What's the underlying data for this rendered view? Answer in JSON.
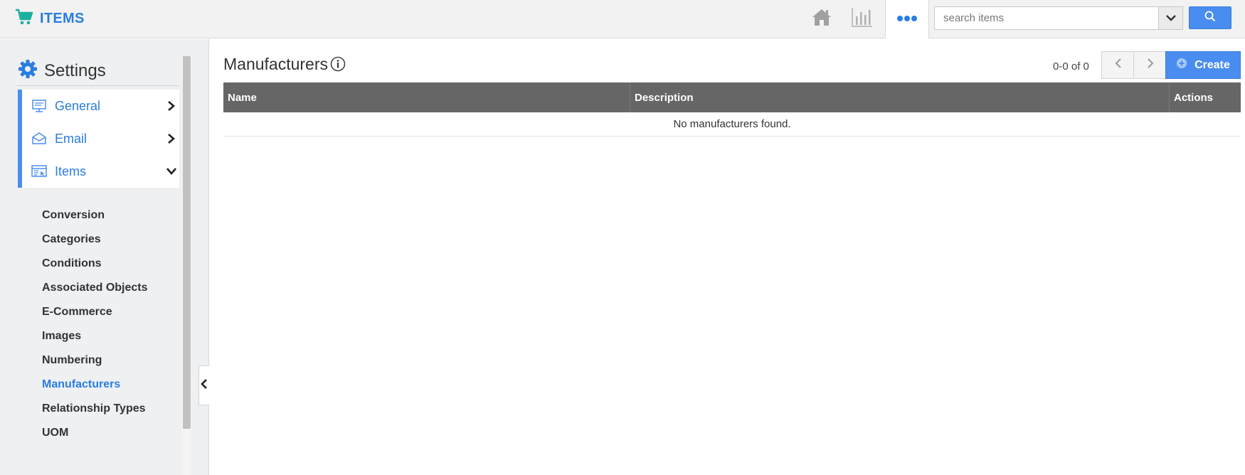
{
  "app": {
    "title": "ITEMS",
    "brand_color": "#2a7de1",
    "cart_icon_color": "#1ab0a0"
  },
  "topbar": {
    "icons": [
      "home-icon",
      "bar-chart-icon",
      "more-dots-icon"
    ],
    "search": {
      "placeholder": "search items",
      "value": ""
    }
  },
  "sidebar": {
    "title": "Settings",
    "sections": [
      {
        "label": "General",
        "icon": "monitor-icon",
        "state": "collapsed"
      },
      {
        "label": "Email",
        "icon": "envelope-icon",
        "state": "collapsed"
      },
      {
        "label": "Items",
        "icon": "items-window-icon",
        "state": "expanded"
      }
    ],
    "sub_items": [
      {
        "label": "Conversion"
      },
      {
        "label": "Categories"
      },
      {
        "label": "Conditions"
      },
      {
        "label": "Associated Objects"
      },
      {
        "label": "E-Commerce"
      },
      {
        "label": "Images"
      },
      {
        "label": "Numbering"
      },
      {
        "label": "Manufacturers",
        "active": true
      },
      {
        "label": "Relationship Types"
      },
      {
        "label": "UOM"
      }
    ]
  },
  "main": {
    "title": "Manufacturers",
    "pager": {
      "count_text": "0-0 of 0"
    },
    "create_label": "Create",
    "table": {
      "columns": [
        "Name",
        "Description",
        "Actions"
      ],
      "rows": [],
      "empty_message": "No manufacturers found."
    }
  },
  "colors": {
    "accent": "#4a8df0",
    "table_header_bg": "#666666",
    "sidebar_bg": "#eef0f2"
  }
}
